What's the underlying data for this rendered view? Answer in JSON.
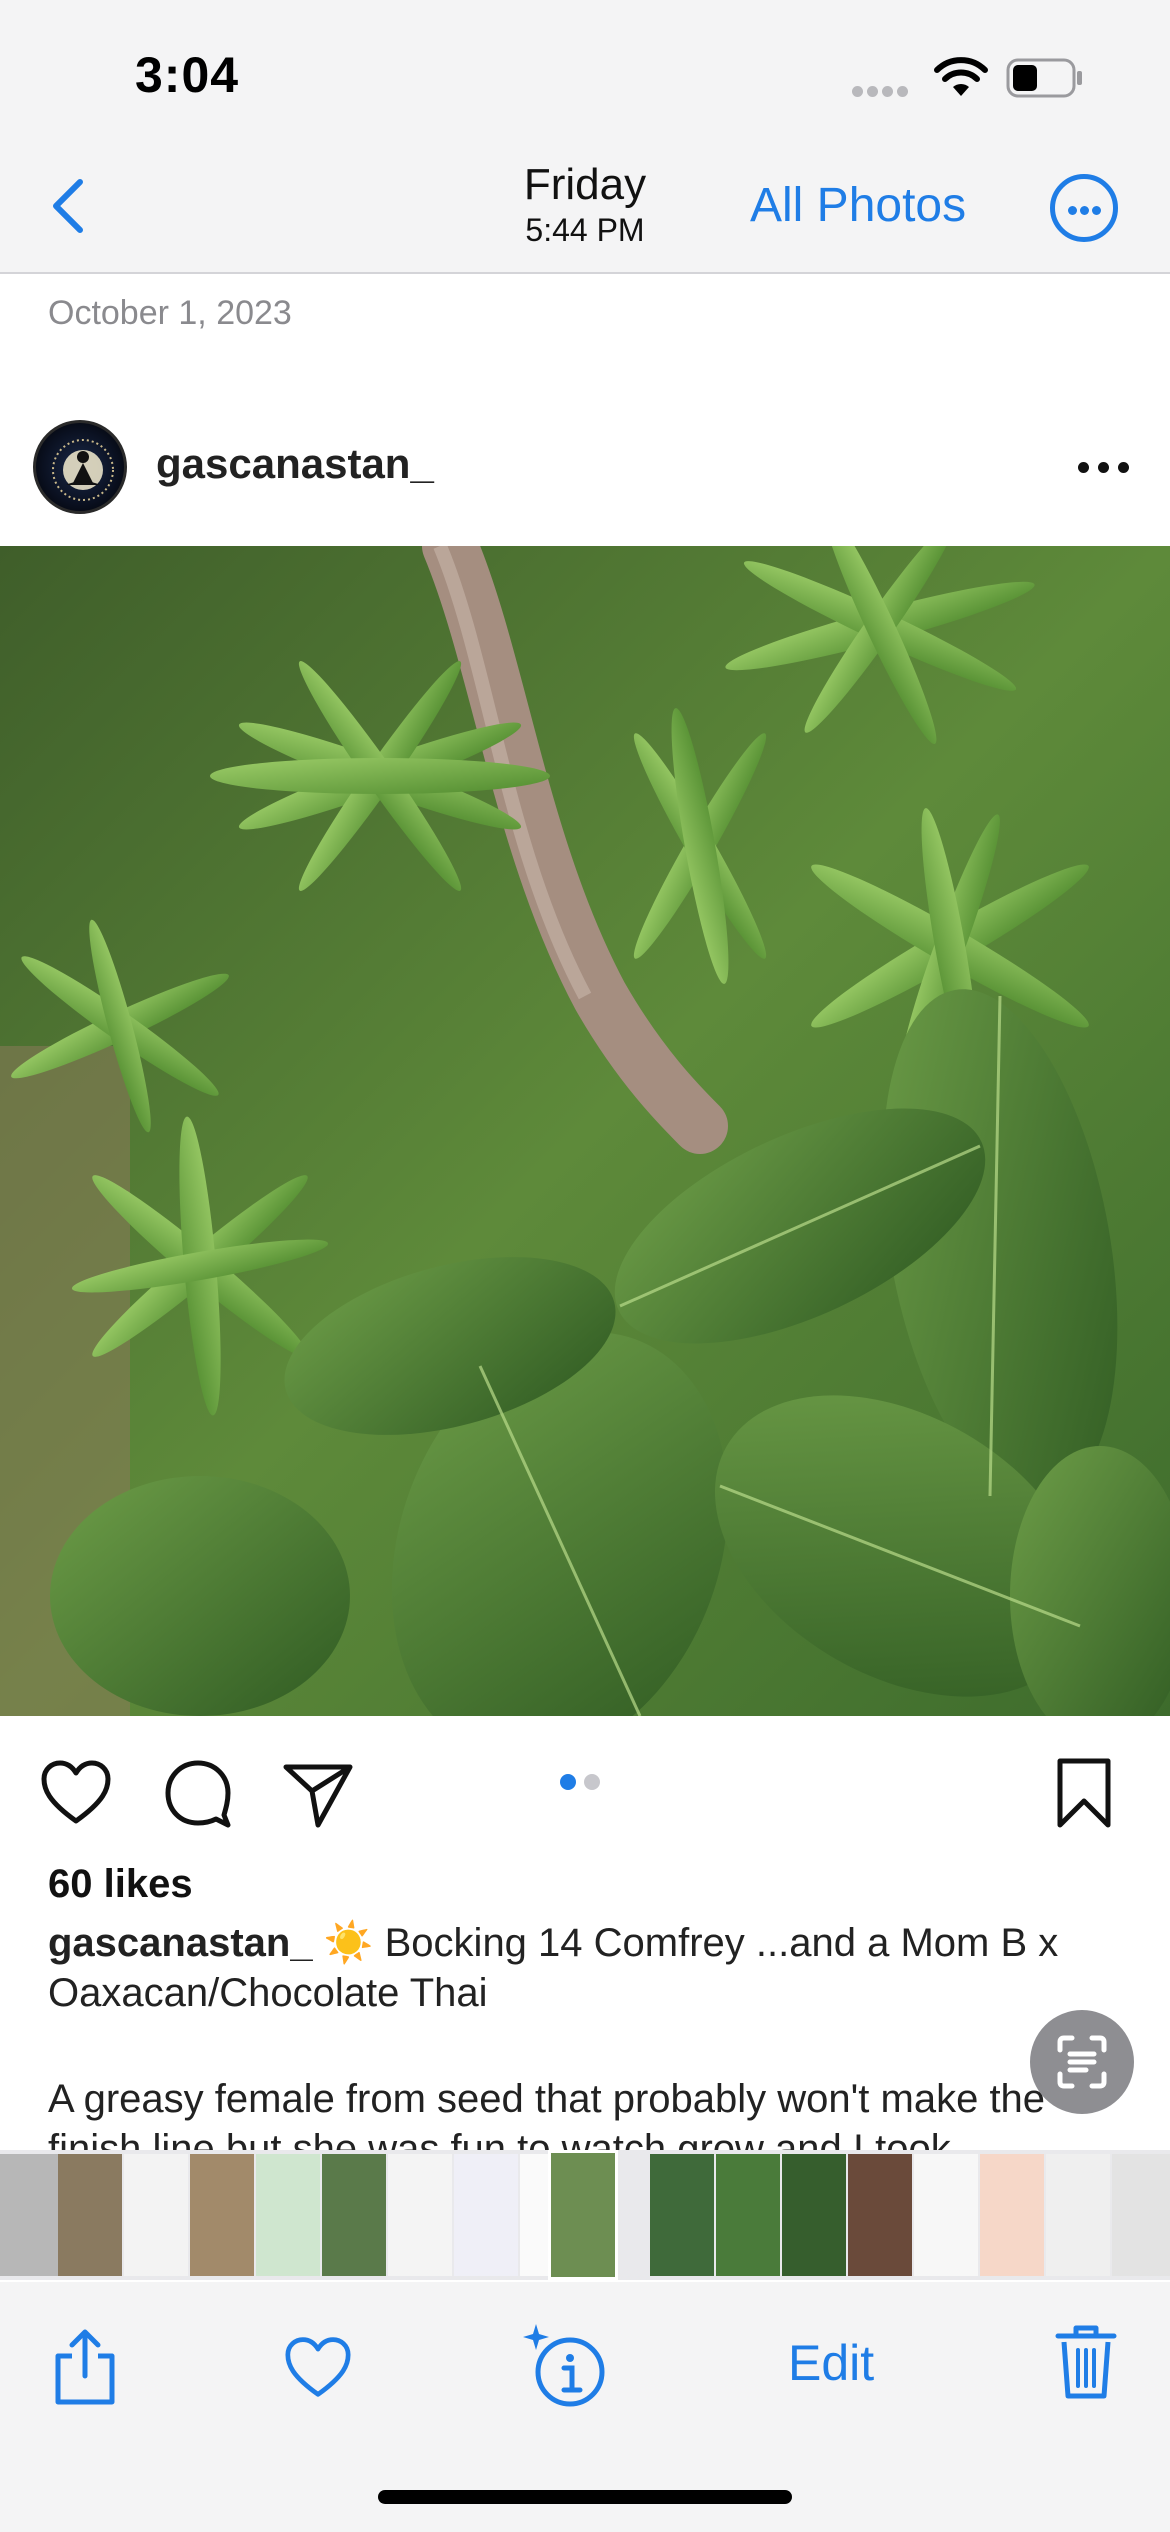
{
  "status_bar": {
    "time": "3:04"
  },
  "nav": {
    "title": "Friday",
    "subtitle": "5:44 PM",
    "all_photos_label": "All Photos"
  },
  "date_label": "October 1, 2023",
  "post": {
    "username": "gascanastan_",
    "likes": "60 likes",
    "caption_user": "gascanastan_",
    "caption_text": " ☀️ Bocking 14 Comfrey ...and a Mom B x Oaxacan/Chocolate Thai",
    "caption_body": "A greasy female from seed that probably won't make the finish line but she was fun to watch grow and I took",
    "carousel": {
      "count": 2,
      "active": 1
    }
  },
  "toolbar": {
    "edit_label": "Edit"
  },
  "colors": {
    "accent": "#1f7de6",
    "carousel_active": "#1f7de6",
    "carousel_inactive": "#c7c7cc"
  },
  "icons": {
    "back": "chevron-left-icon",
    "more": "ellipsis-circle-icon",
    "like": "heart-icon",
    "comment": "comment-bubble-icon",
    "share": "paper-plane-icon",
    "save": "bookmark-icon",
    "live_text": "live-text-icon",
    "toolbar_share": "share-icon",
    "toolbar_favorite": "heart-icon",
    "toolbar_info": "info-sparkle-icon",
    "toolbar_delete": "trash-icon"
  }
}
